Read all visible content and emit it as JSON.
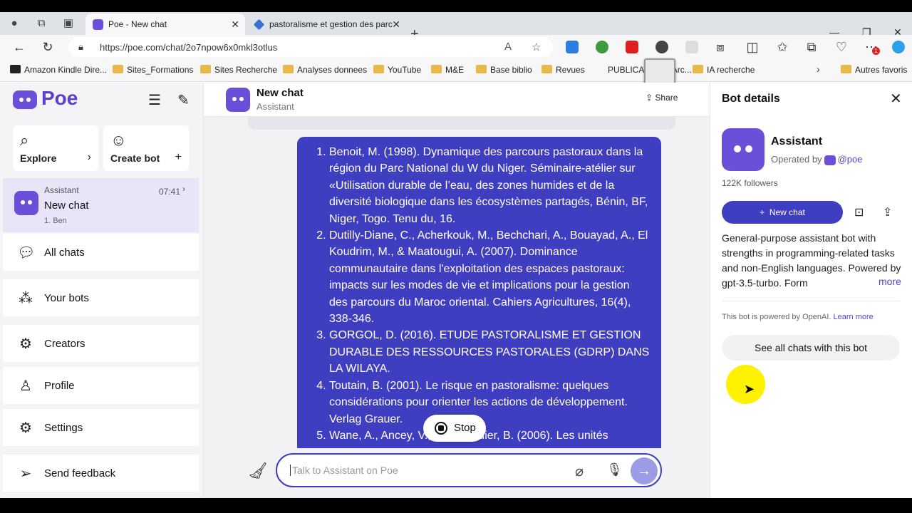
{
  "browser": {
    "tabs": [
      {
        "title": "Poe - New chat",
        "active": true
      },
      {
        "title": "pastoralisme et gestion des parc",
        "active": false
      }
    ],
    "url": "https://poe.com/chat/2o7npow6x0mkl3otlus",
    "extension_badge": "1",
    "bookmarks": [
      "Amazon Kindle Dire...",
      "Sites_Formations",
      "Sites Recherche",
      "Analyses donnees",
      "YouTube",
      "M&E",
      "Base biblio",
      "Revues",
      "PUBLICATIONS Arc...",
      "IA recherche",
      "Autres favoris"
    ]
  },
  "sidebar": {
    "brand": "Poe",
    "explore_label": "Explore",
    "create_bot_label": "Create bot",
    "selected_chat": {
      "bot": "Assistant",
      "time": "07:41",
      "title": "New chat",
      "preview": "1. Ben"
    },
    "nav": [
      {
        "label": "All chats",
        "icon": "chats-icon"
      },
      {
        "label": "Your bots",
        "icon": "bots-icon"
      },
      {
        "label": "Creators",
        "icon": "creators-icon"
      },
      {
        "label": "Profile",
        "icon": "profile-icon"
      },
      {
        "label": "Settings",
        "icon": "settings-icon"
      },
      {
        "label": "Send feedback",
        "icon": "send-icon"
      }
    ]
  },
  "main": {
    "title": "New chat",
    "subtitle": "Assistant",
    "share_label": "Share",
    "message_items": [
      "Benoit, M. (1998). Dynamique des parcours pastoraux dans la région du Parc National du W du Niger. Séminaire-atélier sur «Utilisation durable de l’eau, des zones humides et de la diversité biologique dans les écosystèmes partagés, Bénin, BF, Niger, Togo. Tenu du, 16.",
      "Dutilly-Diane, C., Acherkouk, M., Bechchari, A., Bouayad, A., El Koudrim, M., & Maatougui, A. (2007). Dominance communautaire dans l'exploitation des espaces pastoraux: impacts sur les modes de vie et implications pour la gestion des parcours du Maroc oriental. Cahiers Agricultures, 16(4), 338-346.",
      "GORGOL, D. (2016). ETUDE PASTORALISME ET GESTION DURABLE DES RESSOURCES PASTORALES (GDRP) DANS LA WILAYA.",
      "Toutain, B. (2001). Le risque en pastoralisme: quelques considérations pour orienter les actions de développement. Verlag Grauer.",
      "Wane, A., Ancey, V., & Grosdidier, B. (2006). Les unités"
    ],
    "stop_label": "Stop",
    "input_placeholder": "Talk to Assistant on Poe"
  },
  "details": {
    "header": "Bot details",
    "bot_name": "Assistant",
    "operated_by": "Operated by",
    "handle": "@poe",
    "followers": "122K followers",
    "new_chat_label": "New chat",
    "description": "General-purpose assistant bot with strengths in programming-related tasks and non-English languages. Powered by gpt-3.5-turbo. Form",
    "more_label": "more",
    "powered_text": "This bot is powered by OpenAI.",
    "learn_more": "Learn more",
    "see_all": "See all chats with this bot"
  },
  "colors": {
    "brand": "#5a3fcf",
    "message_bg": "#3f3ec0",
    "sidebar_bg": "#f4f4f6",
    "selected_bg": "#e7e5f7"
  }
}
